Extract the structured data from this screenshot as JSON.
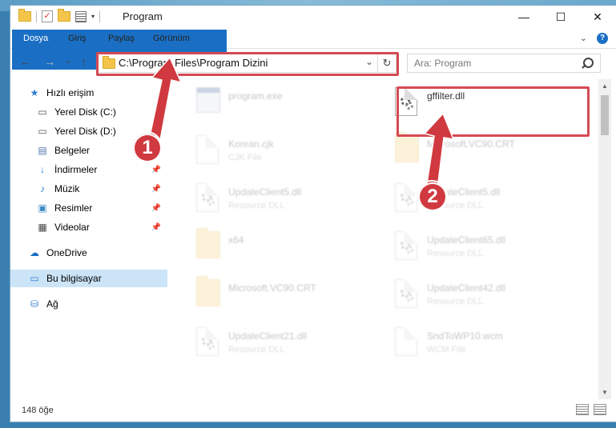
{
  "window": {
    "title": "Program",
    "controls": {
      "minimize": "—",
      "maximize": "☐",
      "close": "✕"
    }
  },
  "ribbon": {
    "tabs": [
      "Dosya",
      "Giriş",
      "Paylaş",
      "Görünüm"
    ],
    "expand_icon": "chevron-down-icon",
    "help_label": "?"
  },
  "navigation": {
    "back": "←",
    "forward": "→",
    "recent": "⌄",
    "up": "↑",
    "address": "C:\\Program Files\\Program Dizini",
    "refresh": "↻",
    "search_placeholder": "Ara: Program"
  },
  "sidebar": {
    "items": [
      {
        "label": "Hızlı erişim",
        "icon": "star-icon"
      },
      {
        "label": "Yerel Disk (C:)",
        "icon": "drive-icon"
      },
      {
        "label": "Yerel Disk (D:)",
        "icon": "drive-icon"
      },
      {
        "label": "Belgeler",
        "icon": "documents-icon"
      },
      {
        "label": "İndirmeler",
        "icon": "download-icon"
      },
      {
        "label": "Müzik",
        "icon": "music-icon"
      },
      {
        "label": "Resimler",
        "icon": "pictures-icon"
      },
      {
        "label": "Videolar",
        "icon": "video-icon"
      },
      {
        "label": "OneDrive",
        "icon": "cloud-icon"
      },
      {
        "label": "Bu bilgisayar",
        "icon": "computer-icon"
      },
      {
        "label": "Ağ",
        "icon": "network-icon"
      }
    ]
  },
  "files": [
    {
      "name": "program.exe",
      "type": "",
      "icon": "exe-icon"
    },
    {
      "name": "gffilter.dll",
      "type": "",
      "icon": "dll-icon"
    },
    {
      "name": "Korean.cjk",
      "type": "CJK File",
      "icon": "document-icon"
    },
    {
      "name": "Microsoft.VC90.CRT",
      "type": "",
      "icon": "folder-icon"
    },
    {
      "name": "UpdateClient5.dll",
      "type": "Resource DLL",
      "icon": "dll-icon"
    },
    {
      "name": "UpdateClient5.dll",
      "type": "Resource DLL",
      "icon": "dll-icon"
    },
    {
      "name": "x64",
      "type": "",
      "icon": "folder-icon"
    },
    {
      "name": "UpdateClient65.dll",
      "type": "Resource DLL",
      "icon": "dll-icon"
    },
    {
      "name": "Microsoft.VC90.CRT",
      "type": "",
      "icon": "folder-icon"
    },
    {
      "name": "UpdateClient42.dll",
      "type": "Resource DLL",
      "icon": "dll-icon"
    },
    {
      "name": "UpdateClient21.dll",
      "type": "Resource DLL",
      "icon": "dll-icon"
    },
    {
      "name": "SndToWP10.wcm",
      "type": "WCM File",
      "icon": "document-icon"
    }
  ],
  "status": {
    "item_count": "148 öğe"
  },
  "callouts": [
    "1",
    "2"
  ],
  "colors": {
    "accent": "#1a6fc4",
    "highlight": "#d44a55",
    "selection": "#cce4f7"
  }
}
